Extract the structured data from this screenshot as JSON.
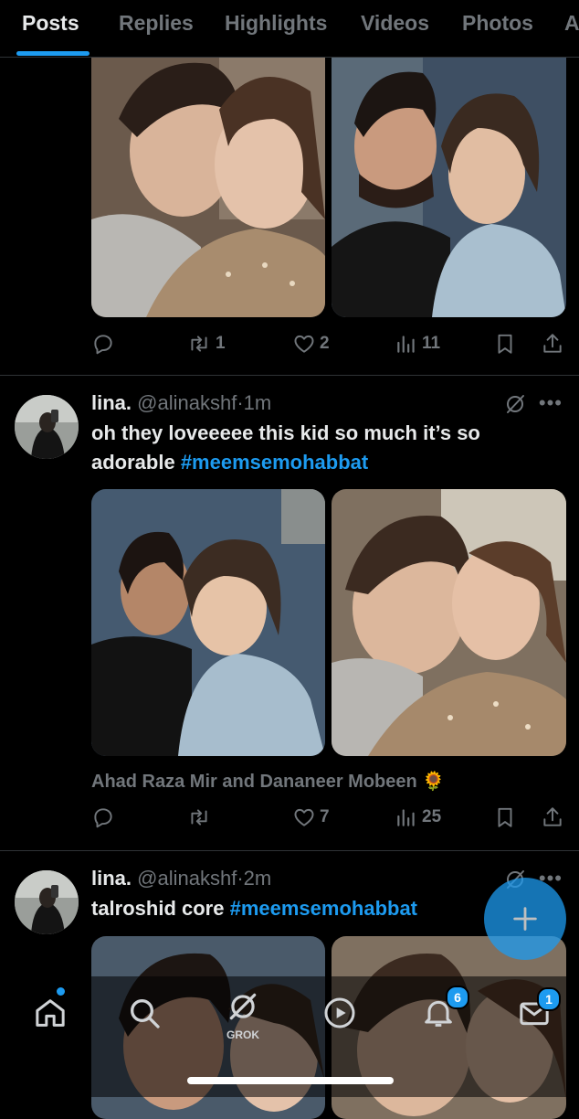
{
  "tabs": [
    {
      "label": "Posts"
    },
    {
      "label": "Replies"
    },
    {
      "label": "Highlights"
    },
    {
      "label": "Videos"
    },
    {
      "label": "Photos"
    },
    {
      "label": "A"
    }
  ],
  "post1": {
    "actions": {
      "reply": "",
      "repost": "1",
      "like": "2",
      "views": "11"
    }
  },
  "post2": {
    "name": "lina.",
    "handle": "@alinakshf",
    "dot": "·",
    "time": "1m",
    "text": "oh they loveeeee this kid so much it’s so adorable ",
    "hashtag": "#meemsemohabbat",
    "caption": "Ahad Raza Mir and Dananeer Mobeen",
    "caption_emoji": "🌻",
    "actions": {
      "reply": "",
      "repost": "",
      "like": "7",
      "views": "25"
    }
  },
  "post3": {
    "name": "lina.",
    "handle": "@alinakshf",
    "dot": "·",
    "time": "2m",
    "text": "talroshid core ",
    "hashtag": "#meemsemohabbat"
  },
  "nav": {
    "grok_label": "GROK",
    "notifications_badge": "6",
    "messages_badge": "1"
  },
  "colors": {
    "accent": "#1d9bf0",
    "background": "#000000",
    "muted": "#71767b"
  }
}
